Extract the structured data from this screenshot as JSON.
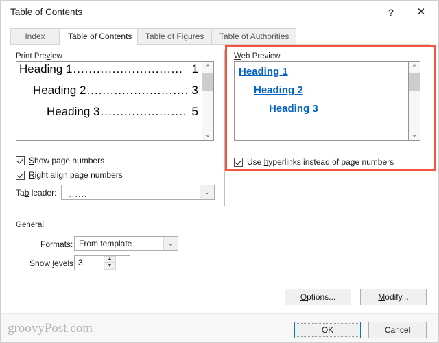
{
  "window": {
    "title": "Table of Contents",
    "help_icon": "question-mark-icon",
    "help_label": "?",
    "close_icon": "close-icon",
    "close_label": "✕"
  },
  "tabs": [
    {
      "label": "Index",
      "accel": "",
      "active": false
    },
    {
      "label": "Table of Contents",
      "accel": "C",
      "active": true
    },
    {
      "label": "Table of Figures",
      "accel": "",
      "active": false
    },
    {
      "label": "Table of Authorities",
      "accel": "",
      "active": false
    }
  ],
  "print_preview": {
    "label_before": "Print Pre",
    "label_accel": "v",
    "label_after": "iew",
    "entries": [
      {
        "text": "Heading 1",
        "leader": "............................",
        "page": "1"
      },
      {
        "text": "Heading 2",
        "leader": "..........................",
        "page": "3"
      },
      {
        "text": "Heading 3",
        "leader": "......................",
        "page": "5"
      }
    ],
    "scrollbar": {
      "up_icon": "chevron-up-icon",
      "up_glyph": "⌃",
      "down_icon": "chevron-down-icon",
      "down_glyph": "⌄"
    }
  },
  "web_preview": {
    "label_accel": "W",
    "label_after": "eb Preview",
    "entries": [
      {
        "text": "Heading 1"
      },
      {
        "text": "Heading 2"
      },
      {
        "text": "Heading 3"
      }
    ],
    "link_color": "#0563C1",
    "scrollbar": {
      "up_icon": "chevron-up-icon",
      "up_glyph": "⌃",
      "down_icon": "chevron-down-icon",
      "down_glyph": "⌄"
    }
  },
  "options": {
    "show_page_numbers": {
      "accel": "S",
      "label_after": "how page numbers",
      "checked": true
    },
    "right_align_page_numbers": {
      "accel": "R",
      "label_after": "ight align page numbers",
      "checked": true
    },
    "use_hyperlinks": {
      "label_before": "Use ",
      "accel": "h",
      "label_after": "yperlinks instead of page numbers",
      "checked": true
    },
    "tab_leader": {
      "label_before": "Ta",
      "label_accel": "b",
      "label_after": " leader:",
      "value": ".......",
      "arrow_icon": "chevron-down-icon",
      "arrow_glyph": "⌄"
    }
  },
  "general": {
    "label": "General",
    "formats": {
      "label_before": "Forma",
      "label_accel": "t",
      "label_after": "s:",
      "value": "From template",
      "arrow_icon": "chevron-down-icon",
      "arrow_glyph": "⌄"
    },
    "show_levels": {
      "label_before": "Show ",
      "label_accel": "l",
      "label_after": "evels:",
      "value": "3",
      "up_icon": "spinner-up-icon",
      "up_glyph": "▲",
      "down_icon": "spinner-down-icon",
      "down_glyph": "▼"
    }
  },
  "buttons": {
    "options": {
      "accel": "O",
      "label_after": "ptions..."
    },
    "modify": {
      "accel": "M",
      "label_after": "odify..."
    },
    "ok": "OK",
    "cancel": "Cancel"
  },
  "watermark": {
    "text": "groovyPost.com"
  },
  "highlight": {
    "color": "#F4553D"
  }
}
